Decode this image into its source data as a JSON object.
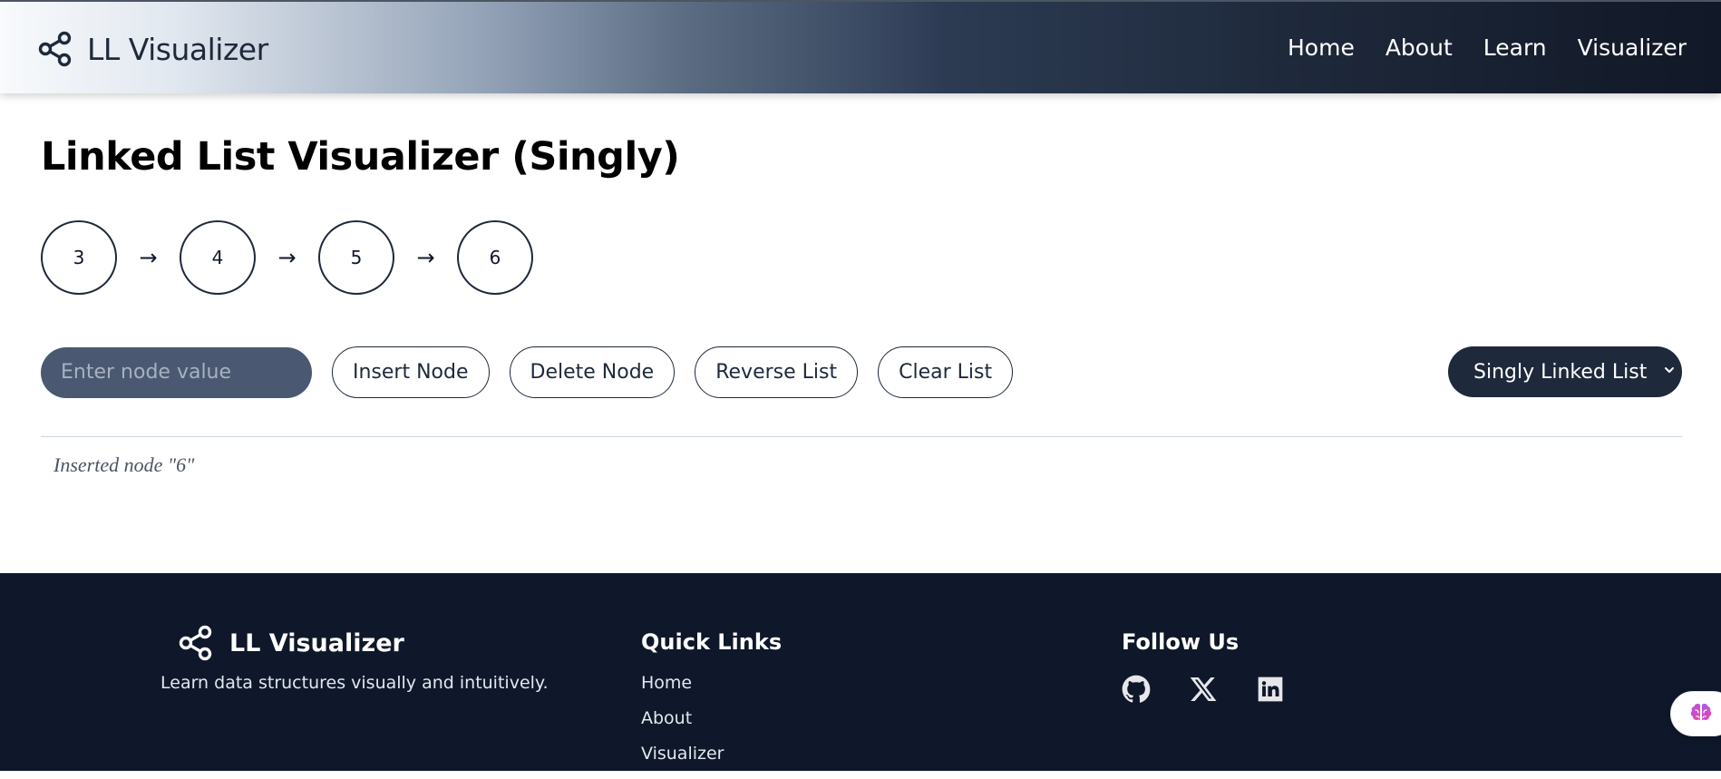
{
  "header": {
    "brand": "LL Visualizer",
    "nav": [
      "Home",
      "About",
      "Learn",
      "Visualizer"
    ]
  },
  "main": {
    "title": "Linked List Visualizer (Singly)",
    "nodes": [
      "3",
      "4",
      "5",
      "6"
    ],
    "arrow": "→",
    "input_placeholder": "Enter node value",
    "buttons": {
      "insert": "Insert Node",
      "delete": "Delete Node",
      "reverse": "Reverse List",
      "clear": "Clear List"
    },
    "list_type_selected": "Singly Linked List",
    "status": "Inserted node \"6\""
  },
  "footer": {
    "brand": "LL Visualizer",
    "tagline": "Learn data structures visually and intuitively.",
    "quick_links_title": "Quick Links",
    "quick_links": [
      "Home",
      "About",
      "Visualizer"
    ],
    "follow_title": "Follow Us",
    "social_icons": [
      "github-icon",
      "x-icon",
      "linkedin-icon"
    ]
  },
  "colors": {
    "primary": "#1e293b",
    "footer_bg": "#0f172a",
    "input_bg": "#4a5971"
  }
}
